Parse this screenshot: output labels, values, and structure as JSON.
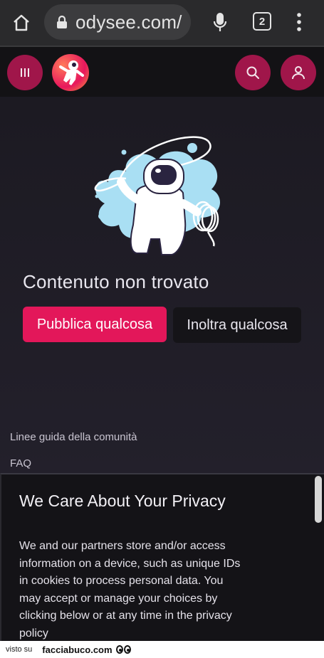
{
  "browser": {
    "url": "odysee.com/",
    "tab_count": "2",
    "icons": [
      "home-icon",
      "lock-icon",
      "microphone-icon",
      "tabs-icon",
      "more-vertical-icon"
    ]
  },
  "header": {
    "icons": [
      "menu-icon",
      "odysee-logo",
      "search-icon",
      "account-icon"
    ]
  },
  "main": {
    "title": "Contenuto non trovato",
    "publish_label": "Pubblica qualcosa",
    "upload_label": "Inoltra qualcosa",
    "footer_links": [
      "Linee guida della comunità",
      "FAQ"
    ]
  },
  "privacy": {
    "title": "We Care About Your Privacy",
    "body": "We and our partners store and/or access information on a device, such as unique IDs in cookies to process personal data. You may accept or manage your choices by clicking below or at any time in the privacy policy"
  },
  "watermark": {
    "left_text": "visto su",
    "site_text": "facciabuco.com"
  },
  "colors": {
    "accent": "#e3175a",
    "header_button": "#a0164a",
    "background": "#1e1c24"
  }
}
